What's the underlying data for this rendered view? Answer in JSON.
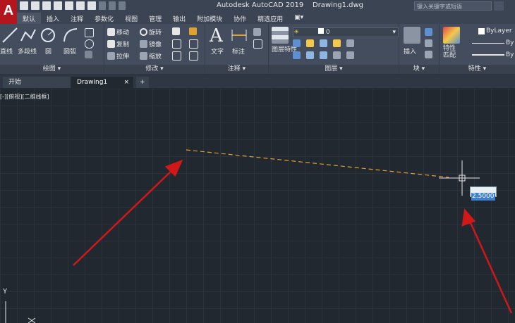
{
  "title": {
    "app": "Autodesk AutoCAD 2019",
    "file": "Drawing1.dwg"
  },
  "search": {
    "placeholder": "键入关键字或短语"
  },
  "menu": [
    "默认",
    "插入",
    "注释",
    "参数化",
    "视图",
    "管理",
    "输出",
    "附加模块",
    "协作",
    "精选应用"
  ],
  "ribbon": {
    "draw": {
      "title": "绘图",
      "line": "直线",
      "polyline": "多段线",
      "circle": "圆",
      "arc": "圆弧"
    },
    "modify": {
      "title": "修改",
      "move": "移动",
      "rotate": "旋转",
      "copy": "复制",
      "mirror": "镜像",
      "stretch": "拉伸",
      "scale": "缩放"
    },
    "annotation": {
      "title": "注释",
      "text": "文字",
      "dimension": "标注"
    },
    "layers": {
      "title": "图层",
      "layer_props": "图层特性",
      "current_layer": "0"
    },
    "block": {
      "title": "块",
      "insert": "插入"
    },
    "properties": {
      "title": "特性",
      "match": "特性匹配",
      "color": "ByLayer",
      "linetype": "By",
      "lineweight": "By"
    }
  },
  "doc_tabs": {
    "start": "开始",
    "drawing": "Drawing1"
  },
  "viewport": {
    "label": "[-][俯视][二维线框]"
  },
  "dynamic_input": {
    "value": "2.5000"
  },
  "ucs": {
    "y_label": "Y"
  },
  "colors": {
    "accent": "#b3161c",
    "dashed_line": "#e0a030",
    "arrow": "#d01818",
    "highlight": "#3f7fd0"
  }
}
